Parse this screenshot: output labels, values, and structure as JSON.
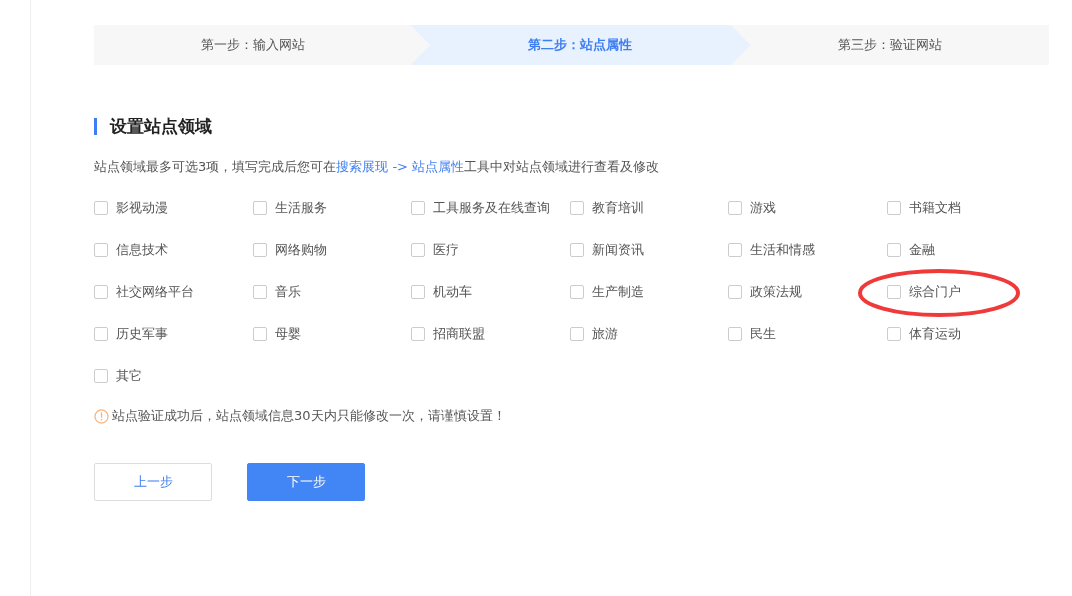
{
  "steps": [
    {
      "label": "第一步：输入网站",
      "selected": false
    },
    {
      "label": "第二步：站点属性",
      "selected": true
    },
    {
      "label": "第三步：验证网站",
      "selected": false
    }
  ],
  "section_title": "设置站点领域",
  "description": {
    "before": "站点领域最多可选3项，填写完成后您可在",
    "link1": "搜索展现",
    "arrow": " -> ",
    "link2": "站点属性",
    "after": "工具中对站点领域进行查看及修改"
  },
  "domains": [
    {
      "label": "影视动漫",
      "checked": false,
      "circled": false
    },
    {
      "label": "生活服务",
      "checked": false,
      "circled": false
    },
    {
      "label": "工具服务及在线查询",
      "checked": false,
      "circled": false
    },
    {
      "label": "教育培训",
      "checked": false,
      "circled": false
    },
    {
      "label": "游戏",
      "checked": false,
      "circled": false
    },
    {
      "label": "书籍文档",
      "checked": false,
      "circled": false
    },
    {
      "label": "信息技术",
      "checked": false,
      "circled": false
    },
    {
      "label": "网络购物",
      "checked": false,
      "circled": false
    },
    {
      "label": "医疗",
      "checked": false,
      "circled": false
    },
    {
      "label": "新闻资讯",
      "checked": false,
      "circled": false
    },
    {
      "label": "生活和情感",
      "checked": false,
      "circled": false
    },
    {
      "label": "金融",
      "checked": false,
      "circled": false
    },
    {
      "label": "社交网络平台",
      "checked": false,
      "circled": false
    },
    {
      "label": "音乐",
      "checked": false,
      "circled": false
    },
    {
      "label": "机动车",
      "checked": false,
      "circled": false
    },
    {
      "label": "生产制造",
      "checked": false,
      "circled": false
    },
    {
      "label": "政策法规",
      "checked": false,
      "circled": false
    },
    {
      "label": "综合门户",
      "checked": false,
      "circled": true
    },
    {
      "label": "历史军事",
      "checked": false,
      "circled": false
    },
    {
      "label": "母婴",
      "checked": false,
      "circled": false
    },
    {
      "label": "招商联盟",
      "checked": false,
      "circled": false
    },
    {
      "label": "旅游",
      "checked": false,
      "circled": false
    },
    {
      "label": "民生",
      "checked": false,
      "circled": false
    },
    {
      "label": "体育运动",
      "checked": false,
      "circled": false
    },
    {
      "label": "其它",
      "checked": false,
      "circled": false
    }
  ],
  "warning": "站点验证成功后，站点领域信息30天内只能修改一次，请谨慎设置！",
  "buttons": [
    {
      "label": "上一步",
      "kind": "secondary"
    },
    {
      "label": "下一步",
      "kind": "primary"
    }
  ]
}
